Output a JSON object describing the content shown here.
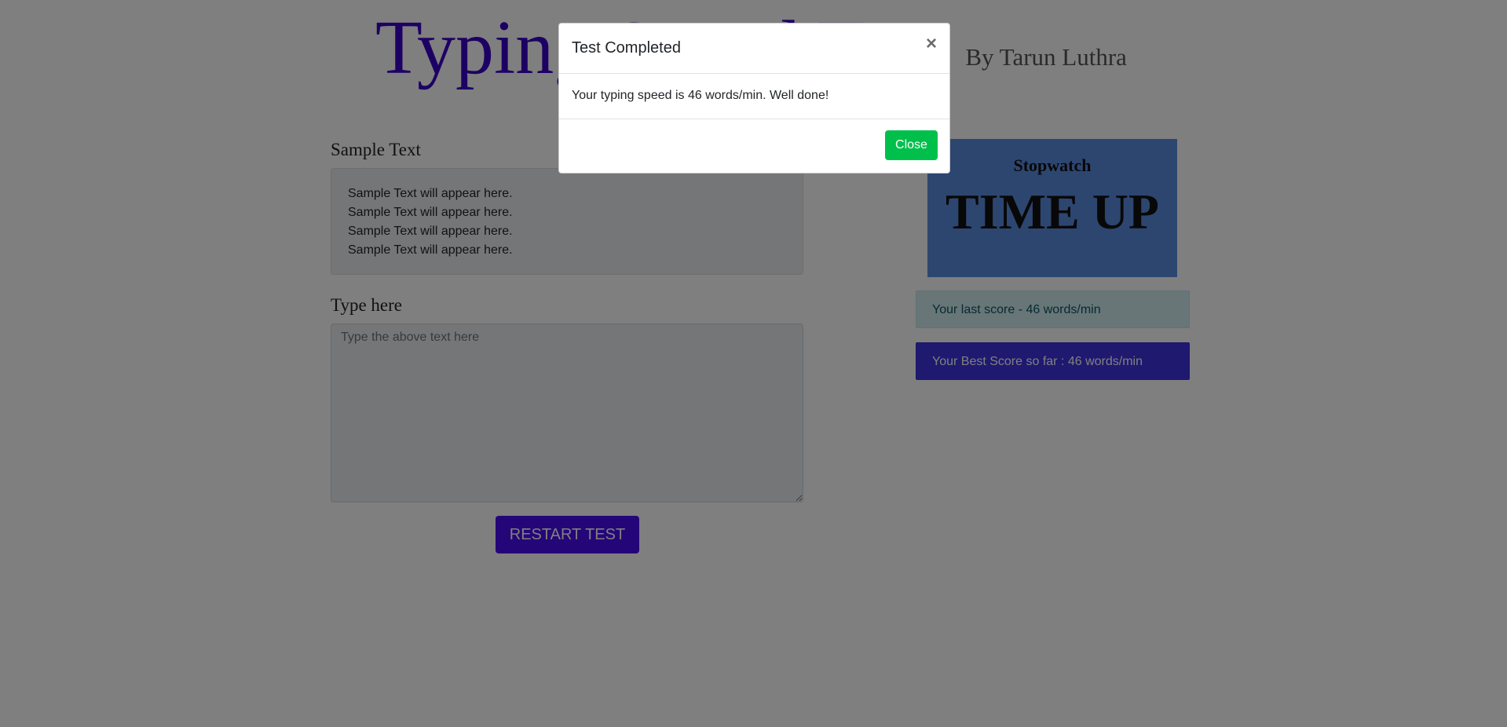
{
  "header": {
    "title": "Typing Speed Test",
    "byline": "By Tarun Luthra"
  },
  "sample": {
    "label": "Sample Text",
    "lines": [
      "Sample Text will appear here.",
      "Sample Text will appear here.",
      "Sample Text will appear here.",
      "Sample Text will appear here."
    ]
  },
  "typing": {
    "label": "Type here",
    "placeholder": "Type the above text here"
  },
  "restart_label": "RESTART TEST",
  "stopwatch": {
    "title": "Stopwatch",
    "time": "TIME UP"
  },
  "scores": {
    "last": "Your last score - 46 words/min",
    "best": "Your Best Score so far : 46 words/min"
  },
  "modal": {
    "title": "Test Completed",
    "close_icon": "×",
    "message": "Your typing speed is 46 words/min. Well done!",
    "close_label": "Close"
  },
  "colors": {
    "title": "#3a00c8",
    "restart_button": "#4b0cf0",
    "stopwatch_bg": "#5b8de0",
    "last_score_bg": "#d1ecf1",
    "best_score_bg": "#3e33e0",
    "close_button": "#00c04b"
  }
}
